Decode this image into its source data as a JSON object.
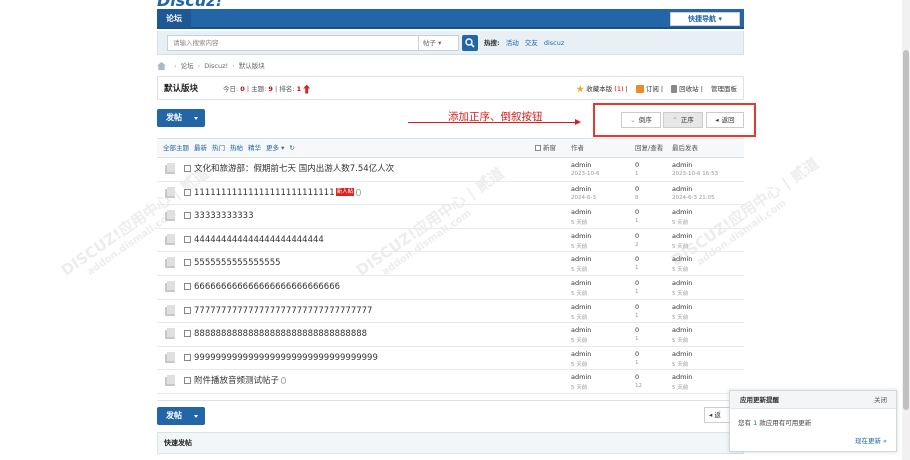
{
  "header": {
    "logo_text": "Discuz!",
    "nav_tab": "论坛",
    "quick_nav": "快捷导航 ▾"
  },
  "search": {
    "placeholder": "请输入搜索内容",
    "type": "帖子 ▾",
    "hot_label": "热搜:",
    "hot_items": [
      "活动",
      "交友",
      "discuz"
    ]
  },
  "breadcrumb": [
    "论坛",
    "Discuz!",
    "默认版块"
  ],
  "forum": {
    "title": "默认版块",
    "today_label": "今日:",
    "today": "0",
    "topics_label": "主题:",
    "topics": "9",
    "rank_label": "排名:",
    "rank": "1",
    "favorite": "收藏本版",
    "favorite_count": "(1)",
    "subscribe": "订阅",
    "recycle": "回收站",
    "manage": "管理面板"
  },
  "post_button": "发帖",
  "annotation": "添加正序、倒叙按钮",
  "sort": {
    "desc": "倒序",
    "asc": "正序",
    "back": "返回"
  },
  "filters": [
    "全部主题",
    "最新",
    "热门",
    "热帖",
    "精华",
    "更多 ▾"
  ],
  "list_head": {
    "new_window": "新窗",
    "author": "作者",
    "replies": "回复/查看",
    "last": "最后发表"
  },
  "threads": [
    {
      "title": "文化和旅游部：假期前七天 国内出游人数7.54亿人次",
      "author": "admin",
      "date": "2023-10-6",
      "replies": "0",
      "views": "1",
      "last_user": "admin",
      "last_time": "2023-10-6 16:53",
      "tag": "",
      "attach": false
    },
    {
      "title": "11111111111111111111111111",
      "author": "admin",
      "date": "2024-6-3",
      "replies": "0",
      "views": "8",
      "last_user": "admin",
      "last_time": "2024-6-3 21:05",
      "tag": "新人帖",
      "attach": true
    },
    {
      "title": "33333333333",
      "author": "admin",
      "date": "5 天前",
      "replies": "0",
      "views": "1",
      "last_user": "admin",
      "last_time": "5 天前",
      "tag": "",
      "attach": false
    },
    {
      "title": "444444444444444444444444",
      "author": "admin",
      "date": "5 天前",
      "replies": "0",
      "views": "2",
      "last_user": "admin",
      "last_time": "5 天前",
      "tag": "",
      "attach": false
    },
    {
      "title": "5555555555555555",
      "author": "admin",
      "date": "5 天前",
      "replies": "0",
      "views": "1",
      "last_user": "admin",
      "last_time": "5 天前",
      "tag": "",
      "attach": false
    },
    {
      "title": "666666666666666666666666666",
      "author": "admin",
      "date": "5 天前",
      "replies": "0",
      "views": "1",
      "last_user": "admin",
      "last_time": "5 天前",
      "tag": "",
      "attach": false
    },
    {
      "title": "777777777777777777777777777777777",
      "author": "admin",
      "date": "5 天前",
      "replies": "0",
      "views": "1",
      "last_user": "admin",
      "last_time": "5 天前",
      "tag": "",
      "attach": false
    },
    {
      "title": "88888888888888888888888888888888",
      "author": "admin",
      "date": "5 天前",
      "replies": "0",
      "views": "1",
      "last_user": "admin",
      "last_time": "5 天前",
      "tag": "",
      "attach": false
    },
    {
      "title": "9999999999999999999999999999999999",
      "author": "admin",
      "date": "5 天前",
      "replies": "0",
      "views": "1",
      "last_user": "admin",
      "last_time": "5 天前",
      "tag": "",
      "attach": false
    },
    {
      "title": "附件播放音频测试帖子",
      "author": "admin",
      "date": "5 天前",
      "replies": "0",
      "views": "12",
      "last_user": "admin",
      "last_time": "5 天前",
      "tag": "",
      "attach": true
    }
  ],
  "bottom_back": "返",
  "quick_post": "快速发帖",
  "notice": {
    "title": "应用更新提醒",
    "close": "关闭",
    "body_prefix": "您有",
    "count": "1",
    "body_suffix": "款应用有可用更新",
    "link": "现在更新 »"
  },
  "watermark": {
    "line1": "DISCUZ!应用中心 | 贰道",
    "line2": "addon.dismall.com"
  }
}
